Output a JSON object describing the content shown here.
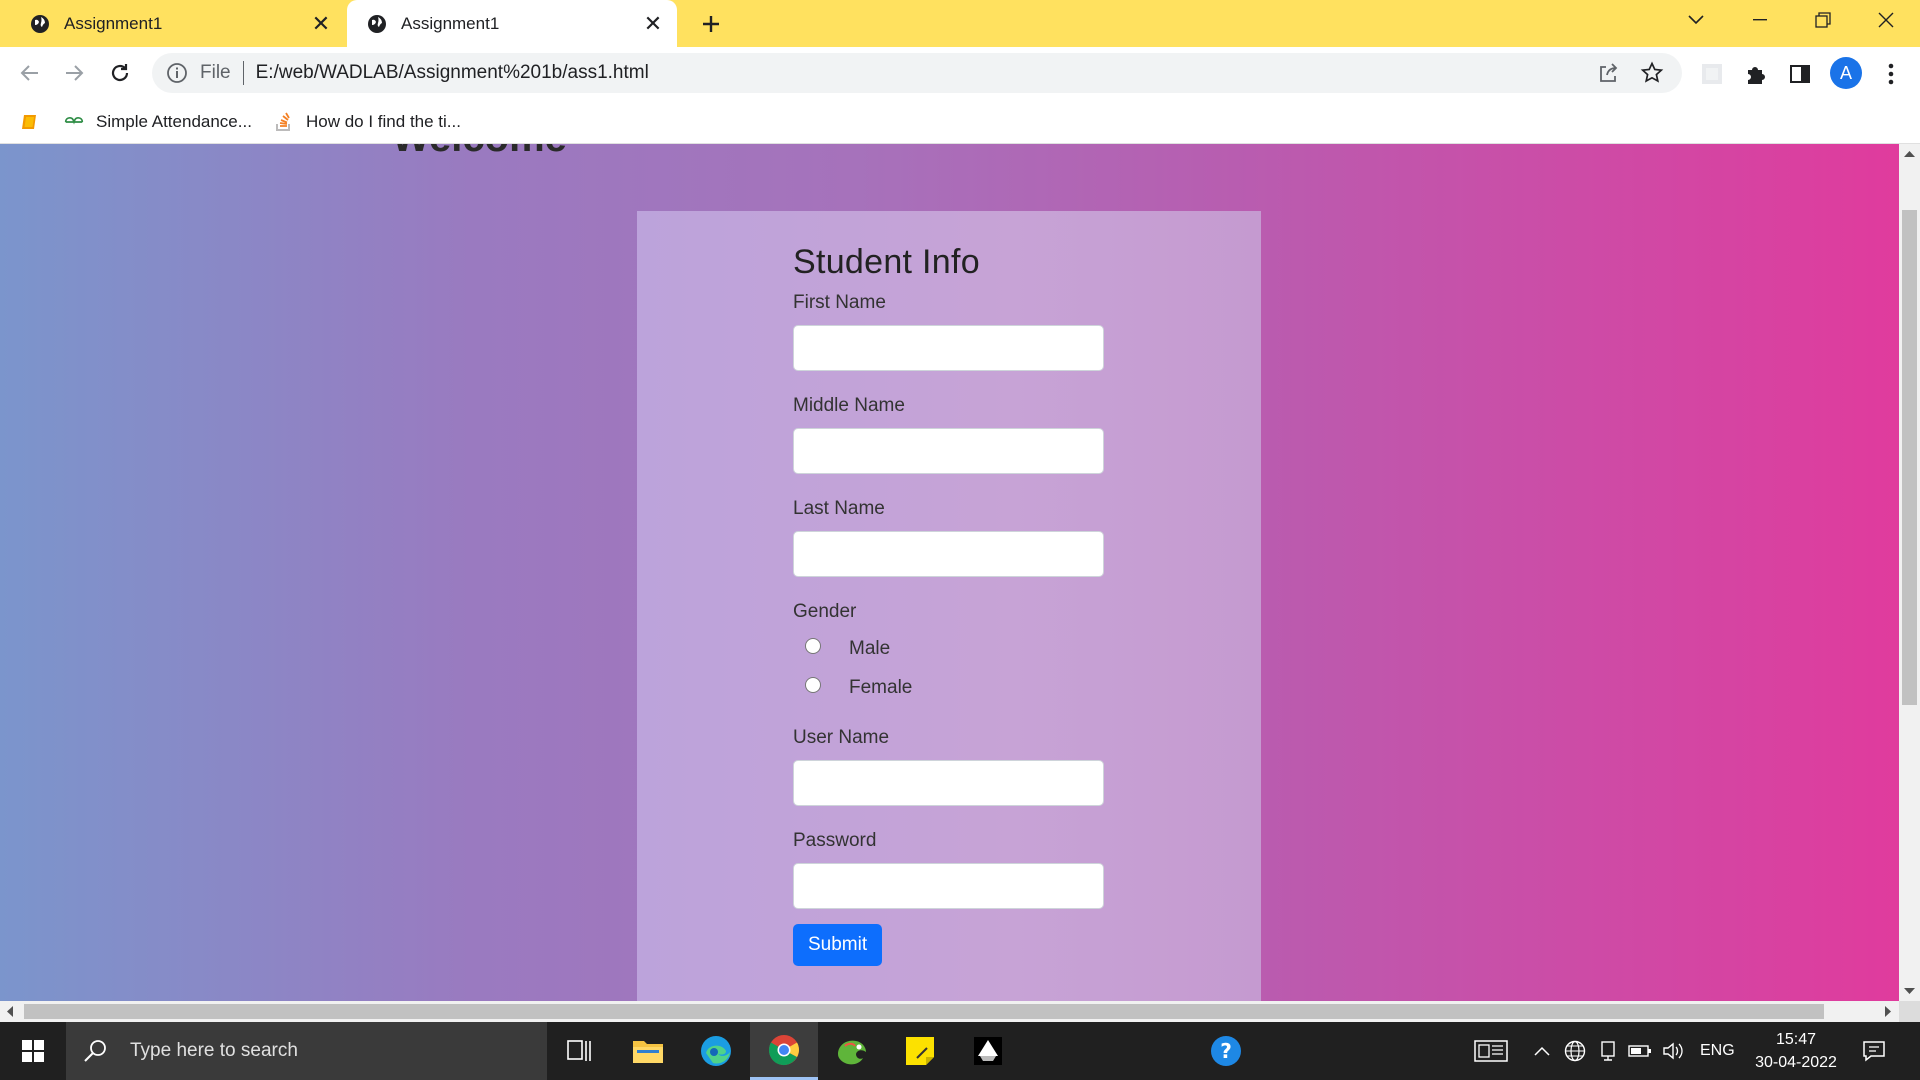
{
  "tabs": [
    {
      "label": "Assignment1",
      "icon": "globe-icon"
    },
    {
      "label": "Assignment1",
      "icon": "globe-icon",
      "active": true
    }
  ],
  "address_bar": {
    "scheme": "File",
    "url": "E:/web/WADLAB/Assignment%201b/ass1.html"
  },
  "profile": {
    "initial": "A",
    "color": "#1a73e8"
  },
  "bookmarks": [
    {
      "label": "",
      "icon": "book-icon"
    },
    {
      "label": "Simple Attendance...",
      "icon": "gfg-icon"
    },
    {
      "label": "How do I find the ti...",
      "icon": "stackoverflow-icon"
    }
  ],
  "page": {
    "welcome": "Welcome",
    "form": {
      "title": "Student Info",
      "first_name_label": "First Name",
      "first_name_value": "",
      "middle_name_label": "Middle Name",
      "middle_name_value": "",
      "last_name_label": "Last Name",
      "last_name_value": "",
      "gender_label": "Gender",
      "gender_options": [
        "Male",
        "Female"
      ],
      "username_label": "User Name",
      "username_value": "",
      "password_label": "Password",
      "password_value": "",
      "submit_label": "Submit"
    },
    "accent": "#0d6efd"
  },
  "taskbar": {
    "search_placeholder": "Type here to search",
    "language": "ENG",
    "time": "15:47",
    "date": "30-04-2022"
  }
}
